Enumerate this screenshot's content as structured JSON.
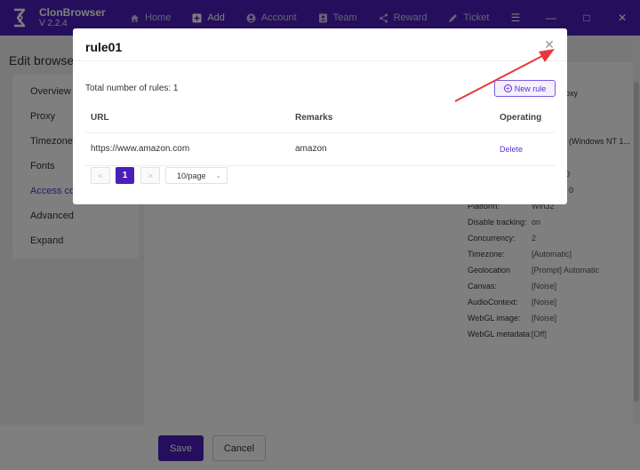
{
  "app": {
    "name": "ClonBrowser",
    "version": "V 2.2.4"
  },
  "nav": [
    {
      "label": "Home",
      "icon": "home-icon"
    },
    {
      "label": "Add",
      "icon": "add-icon"
    },
    {
      "label": "Account",
      "icon": "account-icon"
    },
    {
      "label": "Team",
      "icon": "team-icon"
    },
    {
      "label": "Reward",
      "icon": "share-icon"
    },
    {
      "label": "Ticket",
      "icon": "ticket-icon"
    }
  ],
  "page": {
    "title": "Edit browser"
  },
  "side_menu": [
    {
      "label": "Overview"
    },
    {
      "label": "Proxy"
    },
    {
      "label": "Timezone&"
    },
    {
      "label": "Fonts"
    },
    {
      "label": "Access co"
    },
    {
      "label": "Advanced"
    },
    {
      "label": "Expand"
    }
  ],
  "right_panel": {
    "partial": [
      {
        "text": "oxy"
      },
      {
        "text": "(Windows NT 1..."
      },
      {
        "text": "0"
      },
      {
        "text": "0"
      }
    ],
    "rows": [
      {
        "key": "Platform:",
        "value": "Win32"
      },
      {
        "key": "Disable tracking:",
        "value": "on"
      },
      {
        "key": "Concurrency:",
        "value": "2"
      },
      {
        "key": "Timezone:",
        "value": "[Automatic]"
      },
      {
        "key": "Geolocation",
        "value": "[Prompt] Automatic"
      },
      {
        "key": "Canvas:",
        "value": "[Noise]"
      },
      {
        "key": "AudioContext:",
        "value": "[Noise]"
      },
      {
        "key": "WebGL image:",
        "value": "[Noise]"
      },
      {
        "key": "WebGL metadata:",
        "value": "[Off]"
      }
    ]
  },
  "footer": {
    "save_label": "Save",
    "cancel_label": "Cancel"
  },
  "modal": {
    "title": "rule01",
    "total_text": "Total number of rules: 1",
    "new_rule_label": "New rule",
    "columns": {
      "url": "URL",
      "remarks": "Remarks",
      "operating": "Operating"
    },
    "rows": [
      {
        "url": "https://www.amazon.com",
        "remarks": "amazon",
        "action": "Delete"
      }
    ],
    "pagination": {
      "current": "1",
      "page_size": "10/page",
      "prev": "<",
      "next": ">"
    }
  },
  "colors": {
    "accent": "#4a1fb8",
    "annotation_arrow": "#e8383d"
  }
}
